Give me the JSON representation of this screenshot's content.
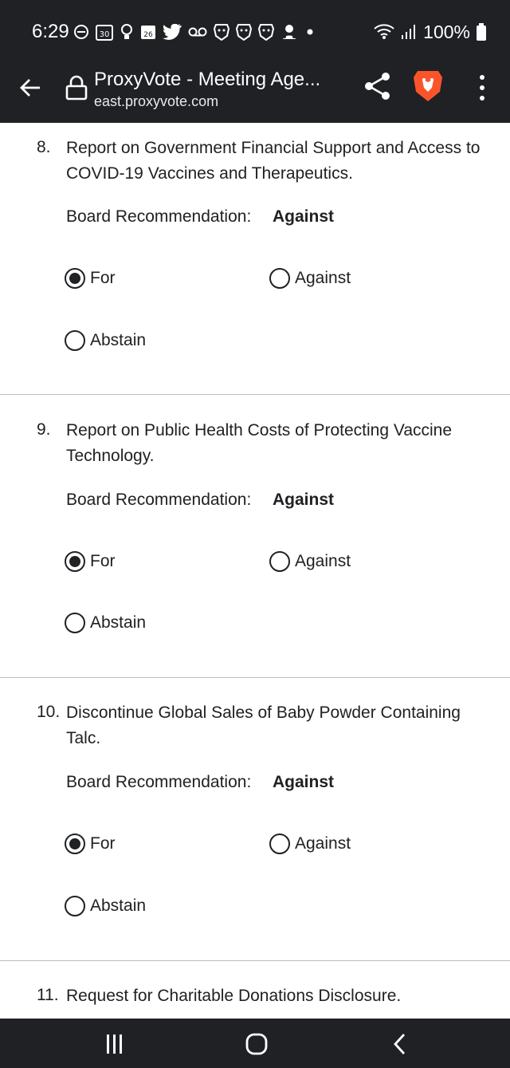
{
  "status": {
    "time": "6:29",
    "icons": [
      "dnd-icon",
      "calendar-30-icon",
      "lightbulb-icon",
      "calendar-26-icon",
      "twitter-icon",
      "voicemail-icon",
      "brave-icon",
      "brave-icon",
      "brave-icon",
      "bot-icon",
      "dot-icon"
    ],
    "battery": "100%"
  },
  "browser": {
    "title": "ProxyVote - Meeting Age...",
    "url": "east.proxyvote.com",
    "accent": "#fb542b"
  },
  "proposals": [
    {
      "number": "8.",
      "text": "Report on Government Financial Support and Access to COVID-19 Vaccines and Therapeutics.",
      "rec_label": "Board Recommendation:",
      "rec_value": "Against",
      "options": [
        {
          "label": "For",
          "selected": true
        },
        {
          "label": "Against",
          "selected": false
        },
        {
          "label": "Abstain",
          "selected": false
        }
      ]
    },
    {
      "number": "9.",
      "text": "Report on Public Health Costs of Protecting Vaccine Technology.",
      "rec_label": "Board Recommendation:",
      "rec_value": "Against",
      "options": [
        {
          "label": "For",
          "selected": true
        },
        {
          "label": "Against",
          "selected": false
        },
        {
          "label": "Abstain",
          "selected": false
        }
      ]
    },
    {
      "number": "10.",
      "text": "Discontinue Global Sales of Baby Powder Containing Talc.",
      "rec_label": "Board Recommendation:",
      "rec_value": "Against",
      "options": [
        {
          "label": "For",
          "selected": true
        },
        {
          "label": "Against",
          "selected": false
        },
        {
          "label": "Abstain",
          "selected": false
        }
      ]
    },
    {
      "number": "11.",
      "text": "Request for Charitable Donations Disclosure."
    }
  ],
  "navbar": [
    "recents-icon",
    "home-icon",
    "back-icon"
  ]
}
